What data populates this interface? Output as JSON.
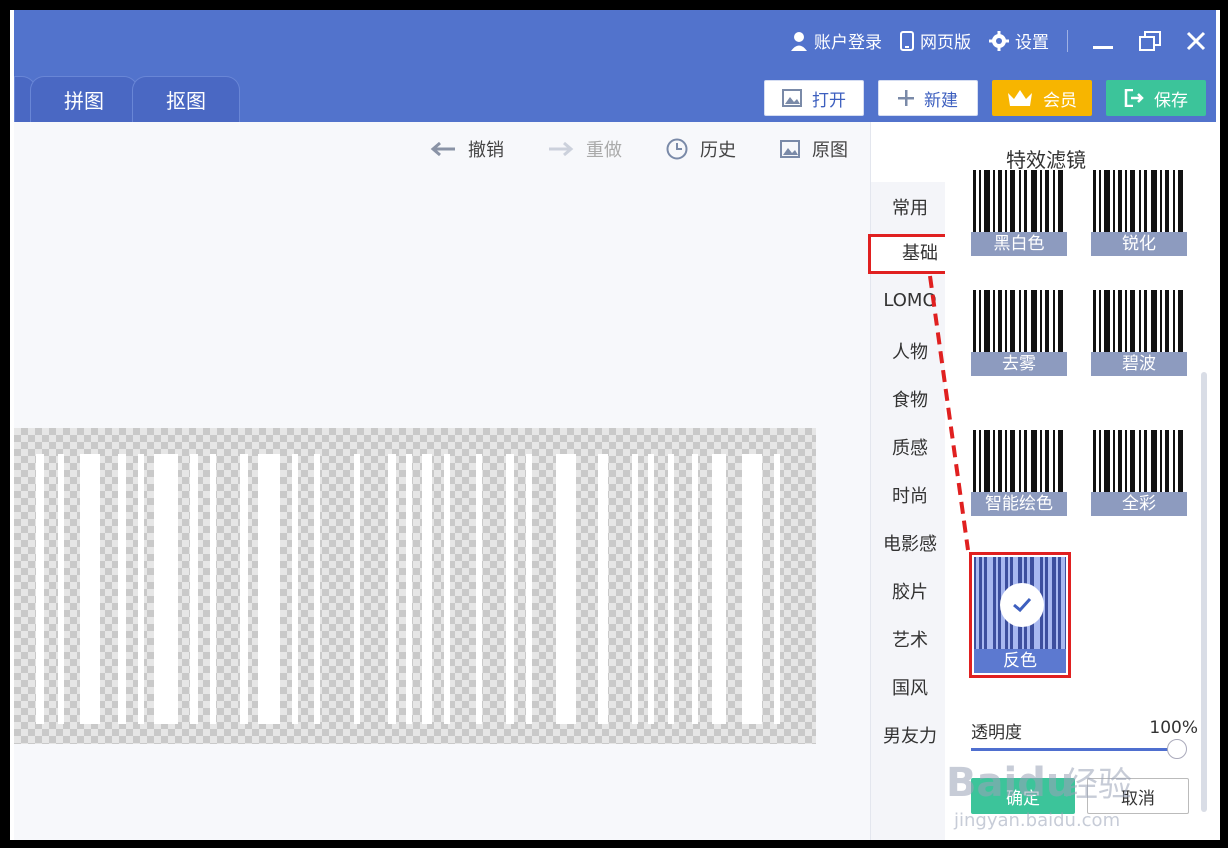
{
  "header": {
    "links": {
      "login": "账户登录",
      "web": "网页版",
      "settings": "设置"
    },
    "tabs": [
      "拼图",
      "抠图"
    ],
    "actions": {
      "open": "打开",
      "new": "新建",
      "member": "会员",
      "save": "保存"
    }
  },
  "toolbar": {
    "undo": "撤销",
    "redo": "重做",
    "history": "历史",
    "original": "原图"
  },
  "panel": {
    "title": "特效滤镜",
    "categories": [
      "常用",
      "基础",
      "LOMO",
      "人物",
      "食物",
      "质感",
      "时尚",
      "电影感",
      "胶片",
      "艺术",
      "国风",
      "男友力"
    ],
    "active_category": "基础",
    "filters": [
      "黑白色",
      "锐化",
      "去雾",
      "碧波",
      "智能绘色",
      "全彩",
      "反色"
    ],
    "selected_filter": "反色",
    "opacity_label": "透明度",
    "opacity_value": "100%",
    "opacity": 1.0,
    "confirm": "确定",
    "cancel": "取消"
  },
  "watermark": {
    "brand": "Baidu经验",
    "url": "jingyan.baidu.com"
  },
  "colors": {
    "header": "#5273cc",
    "accent_green": "#3cc49a",
    "gold": "#f7b500",
    "highlight_red": "#e02020"
  }
}
